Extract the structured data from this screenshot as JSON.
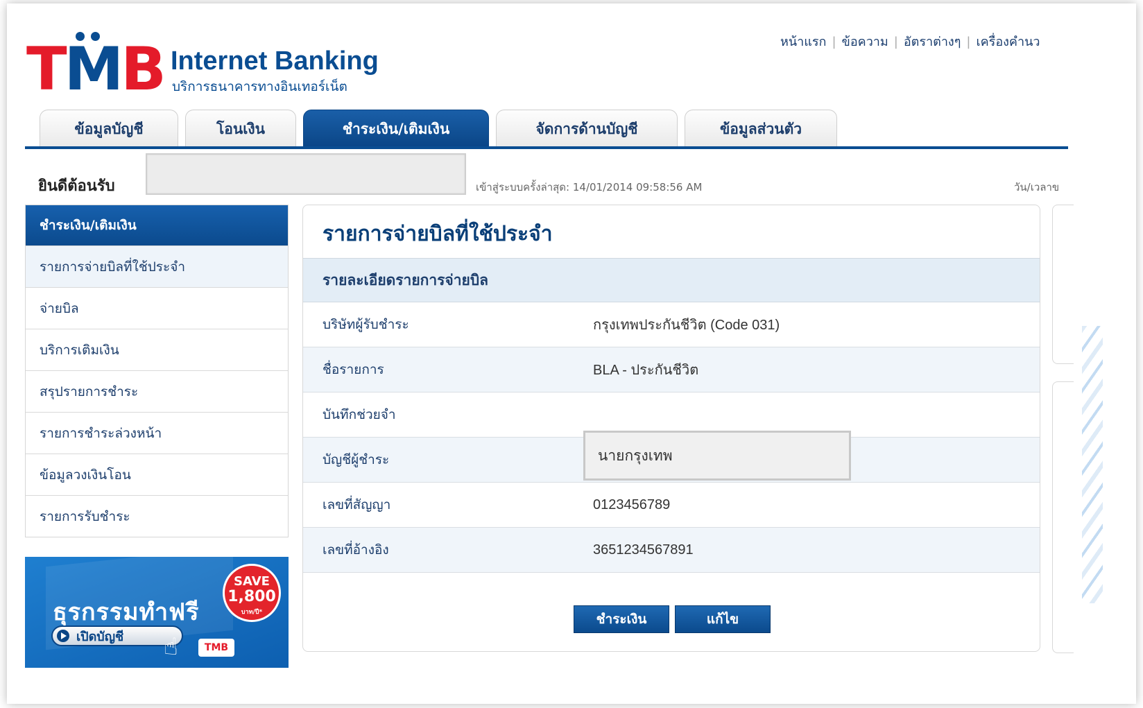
{
  "logo": {
    "brand": "TMB",
    "title": "Internet Banking",
    "subtitle": "บริการธนาคารทางอินเทอร์เน็ต"
  },
  "top_links": [
    "หน้าแรก",
    "ข้อความ",
    "อัตราต่างๆ",
    "เครื่องคำนว"
  ],
  "tabs": [
    {
      "label": "ข้อมูลบัญชี",
      "active": false
    },
    {
      "label": "โอนเงิน",
      "active": false
    },
    {
      "label": "ชำระเงิน/เติมเงิน",
      "active": true
    },
    {
      "label": "จัดการด้านบัญชี",
      "active": false
    },
    {
      "label": "ข้อมูลส่วนตัว",
      "active": false
    }
  ],
  "welcome": "ยินดีต้อนรับ",
  "last_login": "เข้าสู่ระบบครั้งล่าสุด: 14/01/2014 09:58:56 AM",
  "datetime_label": "วัน/เวลาข",
  "sidebar": {
    "heading": "ชำระเงิน/เติมเงิน",
    "items": [
      {
        "label": "รายการจ่ายบิลที่ใช้ประจำ",
        "selected": true
      },
      {
        "label": "จ่ายบิล",
        "selected": false
      },
      {
        "label": "บริการเติมเงิน",
        "selected": false
      },
      {
        "label": "สรุปรายการชำระ",
        "selected": false
      },
      {
        "label": "รายการชำระล่วงหน้า",
        "selected": false
      },
      {
        "label": "ข้อมูลวงเงินโอน",
        "selected": false
      },
      {
        "label": "รายการรับชำระ",
        "selected": false
      }
    ]
  },
  "promo": {
    "title": "ธุรกรรมทำฟรี",
    "button": "เปิดบัญชี",
    "save_line1": "SAVE",
    "save_line2": "1,800",
    "save_line3": "บาท/ปี*",
    "logo": "TMB"
  },
  "panel": {
    "title": "รายการจ่ายบิลที่ใช้ประจำ",
    "subtitle": "รายละเอียดรายการจ่ายบิล",
    "rows": [
      {
        "label": "บริษัทผู้รับชำระ",
        "value": "กรุงเทพประกันชีวิต (Code 031)"
      },
      {
        "label": "ชื่อรายการ",
        "value": "BLA - ประกันชีวิต"
      },
      {
        "label": "บันทึกช่วยจำ",
        "value": ""
      },
      {
        "label": "บัญชีผู้ชำระ",
        "value": "นายกรุงเทพ"
      },
      {
        "label": "เลขที่สัญญา",
        "value": "0123456789"
      },
      {
        "label": "เลขที่อ้างอิง",
        "value": "3651234567891"
      }
    ],
    "buttons": {
      "pay": "ชำระเงิน",
      "edit": "แก้ไข"
    }
  },
  "colors": {
    "brand_blue": "#0a4d92",
    "brand_red": "#e41b2a",
    "row_alt": "#f0f5fa"
  }
}
